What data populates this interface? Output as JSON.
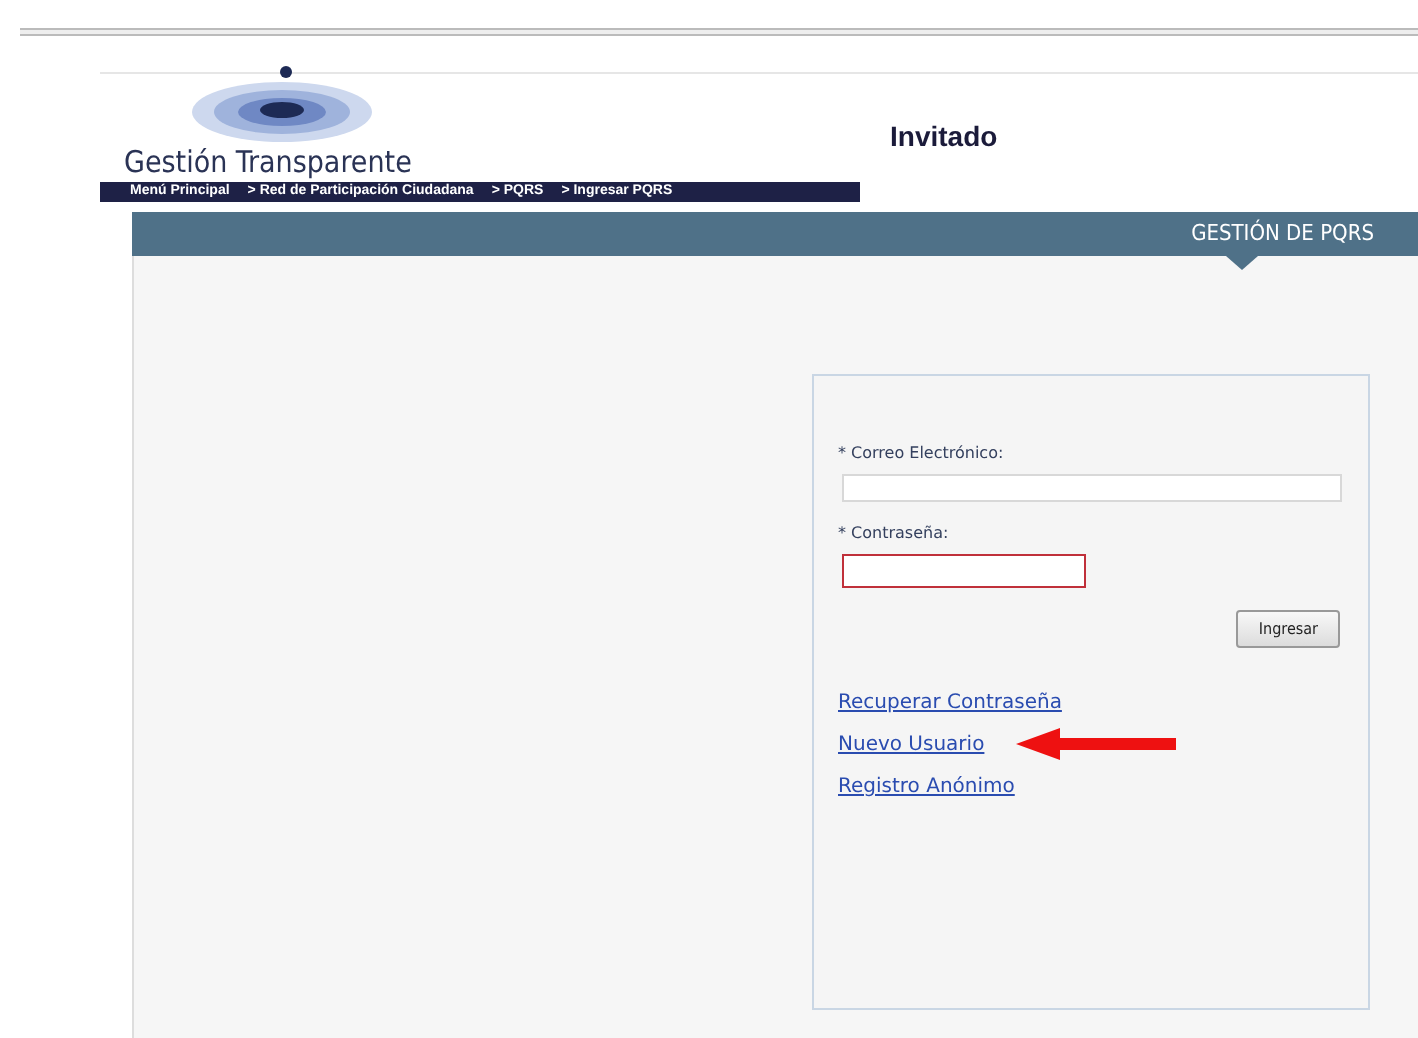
{
  "header": {
    "brand": "Gestión Transparente",
    "user": "Invitado"
  },
  "breadcrumb": [
    "Menú Principal",
    "> Red de Participación Ciudadana",
    "> PQRS",
    "> Ingresar PQRS"
  ],
  "section_title": "GESTIÓN DE PQRS",
  "form": {
    "fields": [
      {
        "label": "* Correo Electrónico:",
        "kind": "text",
        "invalid": false
      },
      {
        "label": "* Contraseña:",
        "kind": "password",
        "invalid": true
      }
    ],
    "submit": "Ingresar",
    "links": [
      {
        "label": "Recuperar Contraseña",
        "highlighted": false
      },
      {
        "label": "Nuevo Usuario",
        "highlighted": true
      },
      {
        "label": "Registro Anónimo",
        "highlighted": false
      }
    ]
  }
}
